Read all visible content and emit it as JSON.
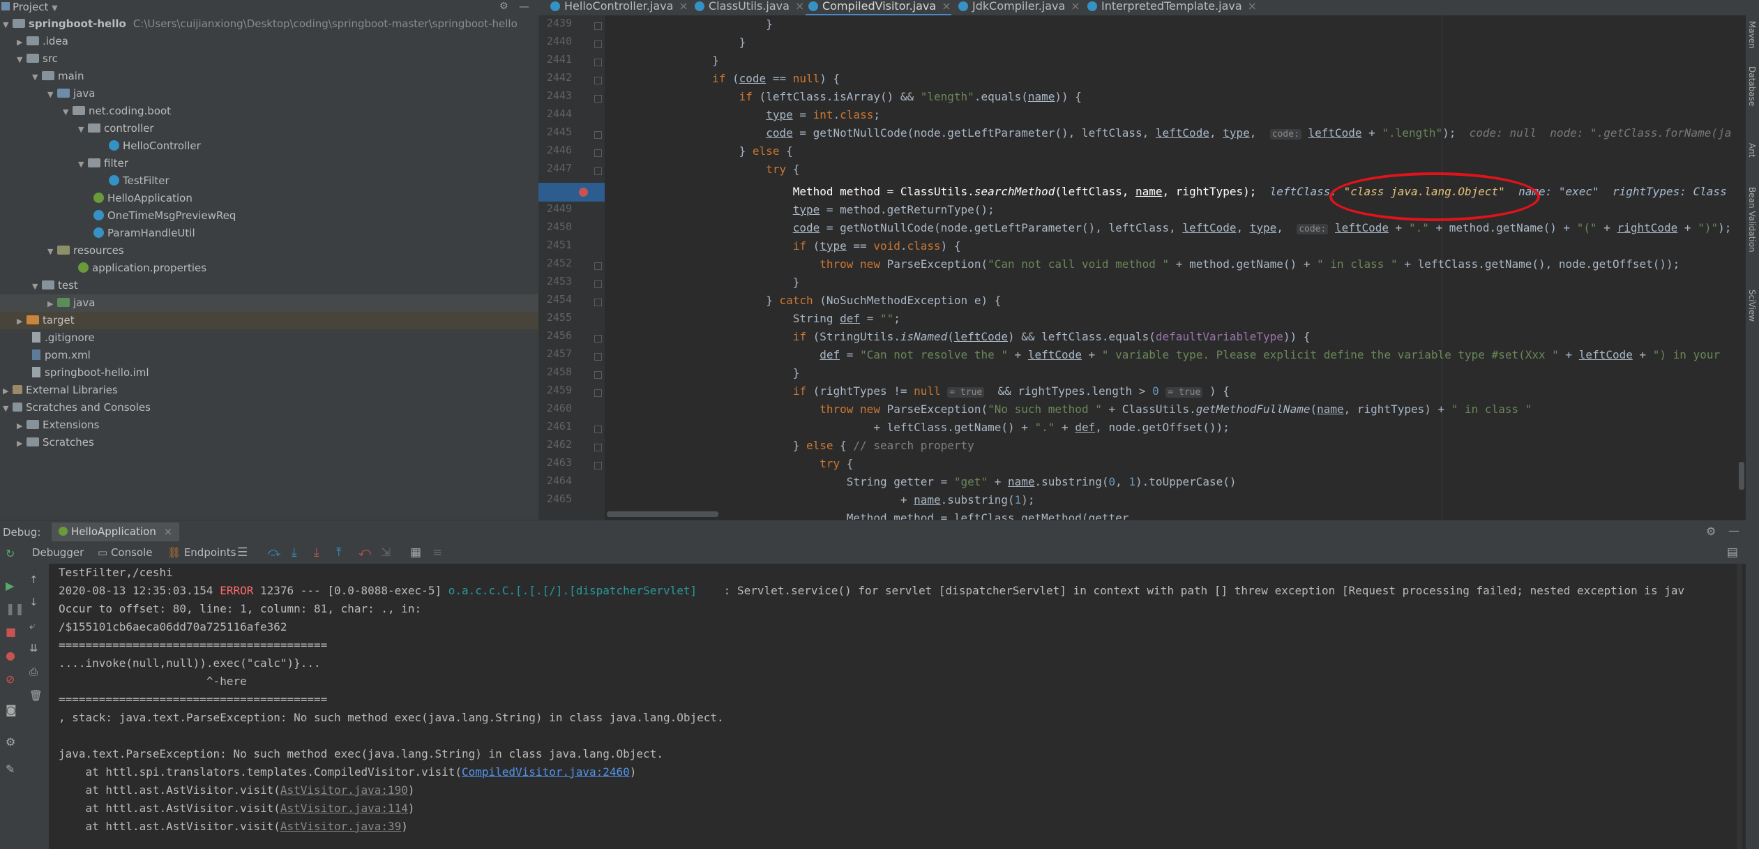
{
  "project_header": {
    "title": "Project"
  },
  "editor_tabs": [
    {
      "label": "HelloController.java",
      "active": false
    },
    {
      "label": "ClassUtils.java",
      "active": false
    },
    {
      "label": "CompiledVisitor.java",
      "active": true
    },
    {
      "label": "JdkCompiler.java",
      "active": false
    },
    {
      "label": "InterpretedTemplate.java",
      "active": false
    }
  ],
  "tree": {
    "root_name": "springboot-hello",
    "root_path": "C:\\Users\\cuijianxiong\\Desktop\\coding\\springboot-master\\springboot-hello",
    "idea": ".idea",
    "src": "src",
    "main": "main",
    "java": "java",
    "pkg": "net.coding.boot",
    "controller": "controller",
    "hello_controller": "HelloController",
    "filter": "filter",
    "test_filter": "TestFilter",
    "hello_app": "HelloApplication",
    "one_time": "OneTimeMsgPreviewReq",
    "param_handle": "ParamHandleUtil",
    "resources": "resources",
    "app_props": "application.properties",
    "test": "test",
    "test_java": "java",
    "target": "target",
    "gitignore": ".gitignore",
    "pom": "pom.xml",
    "iml": "springboot-hello.iml",
    "ext_libs": "External Libraries",
    "scratches_consoles": "Scratches and Consoles",
    "extensions": "Extensions",
    "scratches": "Scratches"
  },
  "line_numbers": [
    "2439",
    "2440",
    "2441",
    "2442",
    "2443",
    "2444",
    "2445",
    "2446",
    "2447",
    "2448",
    "2449",
    "2450",
    "2451",
    "2452",
    "2453",
    "2454",
    "2455",
    "2456",
    "2457",
    "2458",
    "2459",
    "2460",
    "2461",
    "2462",
    "2463",
    "2464",
    "2465"
  ],
  "inline_debug": {
    "hint_2445": "code: null  node: \".getClass.forName(ja",
    "hint_2448_pre": "leftClass: ",
    "hint_2448_val": "\"class java.lang.Object\"",
    "hint_2448_post": "  name: \"exec\"  rightTypes: Class",
    "true_hint": "= true"
  },
  "debug": {
    "label": "Debug:",
    "config": "HelloApplication",
    "tabs": {
      "debugger": "Debugger",
      "console": "Console",
      "endpoints": "Endpoints"
    }
  },
  "console_lines": {
    "l1": "TestFilter,/ceshi",
    "l2_time": "2020-08-13 12:35:03.154 ",
    "l2_level": "ERROR",
    "l2_pid": " 12376 --- [0.0-8088-exec-5] ",
    "l2_logger": "o.a.c.c.C.[.[.[/].[dispatcherServlet]",
    "l2_msg": "    : Servlet.service() for servlet [dispatcherServlet] in context with path [] threw exception [Request processing failed; nested exception is jav",
    "l3": "Occur to offset: 80, line: 1, column: 81, char: ., in:",
    "l4": "/$155101cb6aeca06dd70a725116afe362",
    "l5": "========================================",
    "l6": "....invoke(null,null)).exec(\"calc\")}...",
    "l7": "                      ^-here",
    "l8": "========================================",
    "l9": ", stack: java.text.ParseException: No such method exec(java.lang.String) in class java.lang.Object.",
    "l10": "",
    "l11": "java.text.ParseException: No such method exec(java.lang.String) in class java.lang.Object.",
    "l12_pre": "    at httl.spi.translators.templates.CompiledVisitor.visit(",
    "l12_link": "CompiledVisitor.java:2460",
    "l13_pre": "    at httl.ast.AstVisitor.visit(",
    "l13_link": "AstVisitor.java:190",
    "l14_pre": "    at httl.ast.AstVisitor.visit(",
    "l14_link": "AstVisitor.java:114",
    "l15_pre": "    at httl.ast.AstVisitor.visit(",
    "l15_link": "AstVisitor.java:39",
    "close_paren": ")"
  },
  "right_tool_tabs": [
    "Maven",
    "Database",
    "Ant",
    "Bean Validation",
    "SciView"
  ],
  "colors": {
    "selection": "#2d5c8f",
    "annotation": "#e0131b",
    "keyword": "#cc7832",
    "string": "#6a8759",
    "error": "#ff6b68"
  }
}
